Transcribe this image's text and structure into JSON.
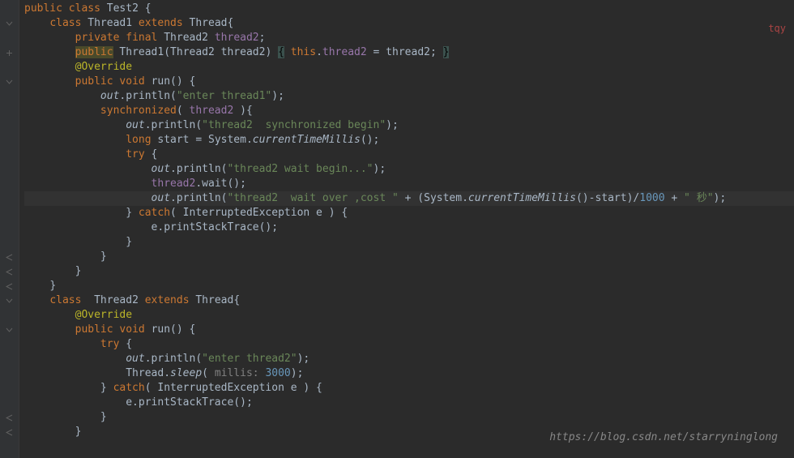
{
  "watermark": "tqy",
  "footer_url": "https://blog.csdn.net/starryninglong",
  "code": {
    "l1": {
      "public": "public",
      "class": "class",
      "name": "Test2",
      "brace": "{"
    },
    "l2": {
      "class": "class",
      "name": "Thread1",
      "extends": "extends",
      "parent": "Thread",
      "brace": "{"
    },
    "l3": {
      "private": "private",
      "final": "final",
      "type": "Thread2",
      "name": "thread2",
      "semi": ";"
    },
    "l4": {
      "public": "public",
      "name": "Thread1",
      "params": "(Thread2 thread2)",
      "ob": "{",
      "body": " ",
      "this": "this",
      "dot": ".",
      "field": "thread2",
      "eq": " = thread2; ",
      "cb": "}"
    },
    "l5": {
      "ann": "@Override"
    },
    "l6": {
      "public": "public",
      "void": "void",
      "name": "run",
      "params": "()",
      "brace": "{"
    },
    "l7": {
      "out": "out",
      "call": ".println(",
      "str": "\"enter thread1\"",
      "end": ");"
    },
    "l8": {
      "sync": "synchronized",
      "open": "( ",
      "field": "thread2",
      "close": " ){"
    },
    "l9": {
      "out": "out",
      "call": ".println(",
      "str": "\"thread2  synchronized begin\"",
      "end": ");"
    },
    "l10": {
      "long": "long",
      "var": "start = System.",
      "method": "currentTimeMillis",
      "end": "();"
    },
    "l11": {
      "try": "try",
      "brace": "{"
    },
    "l12": {
      "out": "out",
      "call": ".println(",
      "str": "\"thread2 wait begin...\"",
      "end": ");"
    },
    "l13": {
      "field": "thread2",
      "call": ".wait();"
    },
    "l14": {
      "out": "out",
      "call": ".println(",
      "str1": "\"thread2  wait over ,cost \"",
      "plus": " + (System.",
      "method": "currentTimeMillis",
      "mid": "()-start)/",
      "num": "1000",
      "plus2": " + ",
      "str2": "\" 秒\"",
      "end": ");"
    },
    "l15": {
      "cb": "}",
      "catch": "catch",
      "open": "( InterruptedException e ) {",
      "x": ""
    },
    "l16": {
      "call": "e.printStackTrace();"
    },
    "l17": {
      "cb": "}"
    },
    "l18": {
      "cb": "}"
    },
    "l19": {
      "cb": "}"
    },
    "l20": {
      "cb": "}"
    },
    "l21": {
      "class": "class",
      "name": "Thread2",
      "extends": "extends",
      "parent": "Thread",
      "brace": "{"
    },
    "l22": {
      "ann": "@Override"
    },
    "l23": {
      "public": "public",
      "void": "void",
      "name": "run",
      "params": "()",
      "brace": "{"
    },
    "l24": {
      "try": "try",
      "brace": "{"
    },
    "l25": {
      "out": "out",
      "call": ".println(",
      "str": "\"enter thread2\"",
      "end": ");"
    },
    "l26": {
      "thread": "Thread.",
      "sleep": "sleep",
      "open": "( ",
      "hint": "millis: ",
      "num": "3000",
      "end": ");"
    },
    "l27": {
      "cb": "}",
      "catch": "catch",
      "open": "( InterruptedException e ) {"
    },
    "l28": {
      "call": "e.printStackTrace();"
    },
    "l29": {
      "cb": "}"
    },
    "l30": {
      "cb": "}"
    }
  }
}
